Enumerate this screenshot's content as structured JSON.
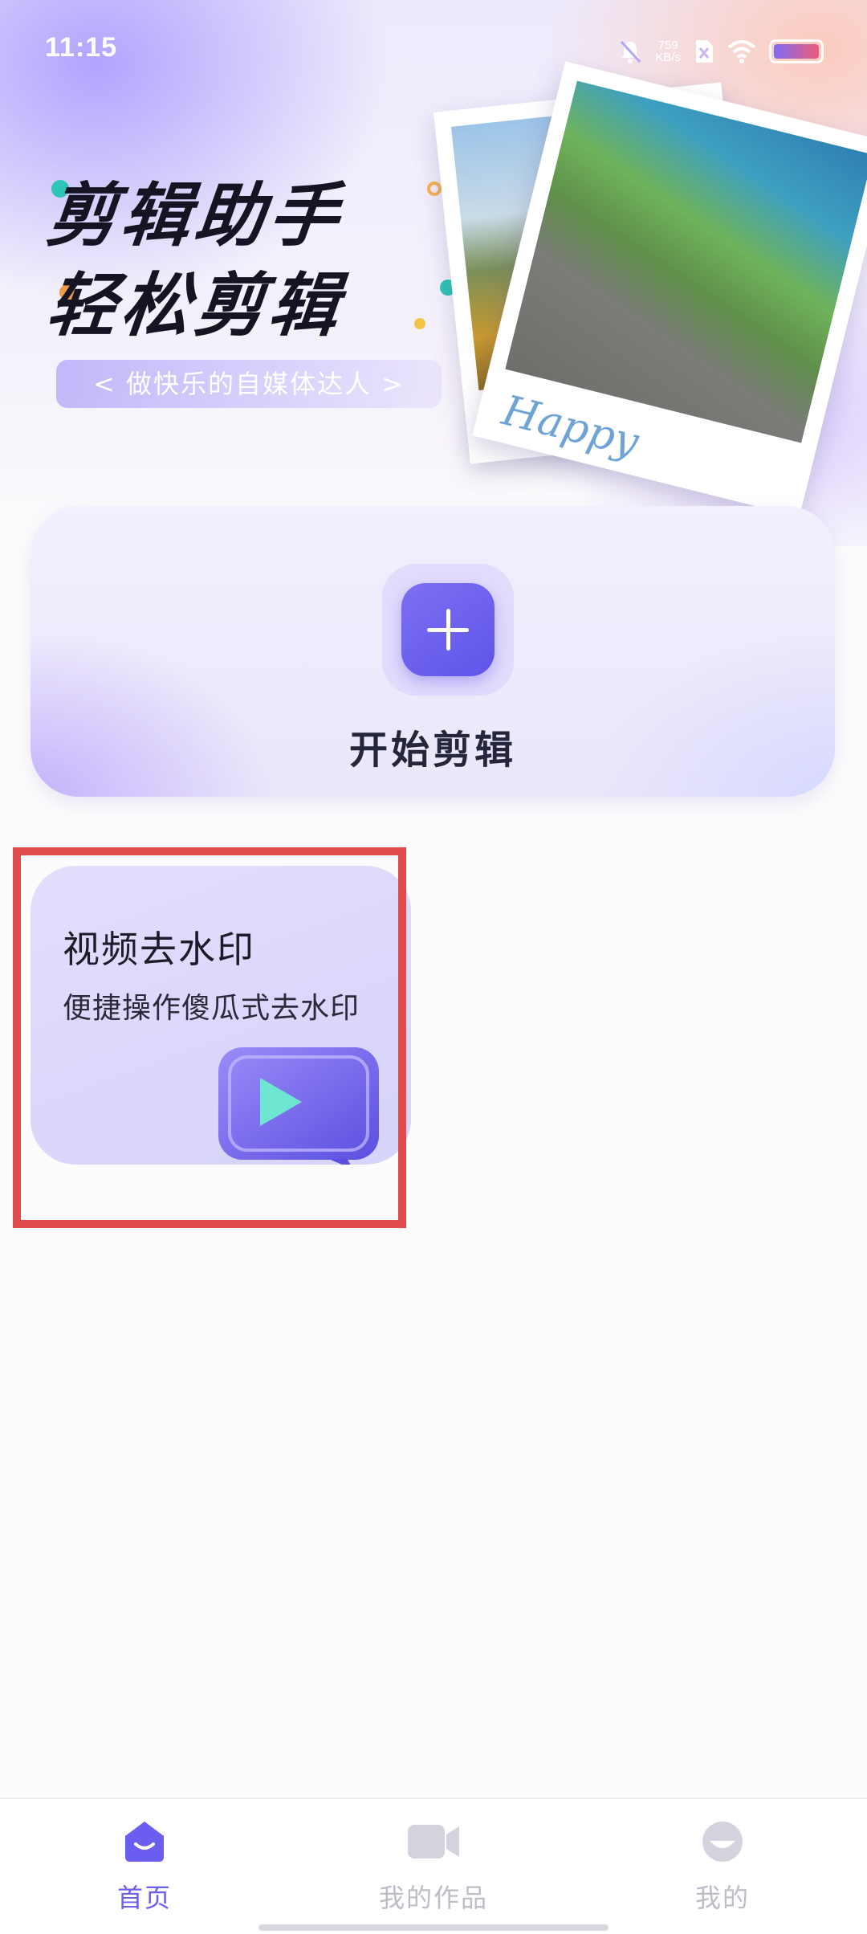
{
  "status_bar": {
    "time": "11:15",
    "net_speed_value": "759",
    "net_speed_unit": "KB/s",
    "icons": [
      "mute-icon",
      "no-sim-icon",
      "wifi-icon",
      "battery-icon"
    ]
  },
  "banner": {
    "title_line1": "剪辑助手",
    "title_line2": "轻松剪辑",
    "slogan": "< 做快乐的自媒体达人 >",
    "photo_caption": "Happy"
  },
  "start_card": {
    "label": "开始剪辑",
    "icon": "plus-icon"
  },
  "features": [
    {
      "title": "视频去水印",
      "subtitle": "便捷操作傻瓜式去水印",
      "icon": "video-play-bubble-icon"
    }
  ],
  "bottom_nav": {
    "items": [
      {
        "label": "首页",
        "icon": "home-icon",
        "active": true
      },
      {
        "label": "我的作品",
        "icon": "video-camera-icon",
        "active": false
      },
      {
        "label": "我的",
        "icon": "profile-icon",
        "active": false
      }
    ]
  },
  "colors": {
    "accent": "#6b5df0",
    "highlight_border": "#e04b4b",
    "nav_inactive": "#bdbcc8"
  }
}
